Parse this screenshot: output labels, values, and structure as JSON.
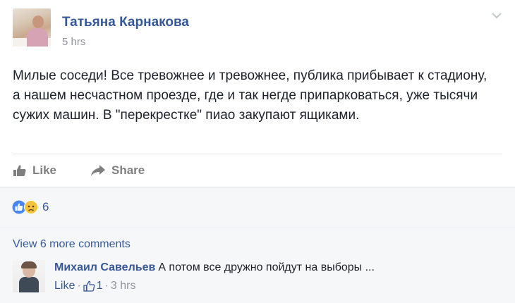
{
  "post": {
    "author": "Татьяна Карнакова",
    "timestamp": "5 hrs",
    "text": "Милые соседи! Все тревожнее и тревожнее, публика прибывает к стадиону, а нашем несчастном проезде, где и так негде припарковаться, уже тысячи сужих машин. В \"перекрестке\" пиао закупают ящиками."
  },
  "actions": {
    "like_label": "Like",
    "share_label": "Share"
  },
  "reactions": {
    "count": "6",
    "types": [
      "like",
      "sad"
    ]
  },
  "comments": {
    "view_more_label": "View 6 more comments",
    "items": [
      {
        "author": "Михаил Савельев",
        "text": "А потом все дружно пойдут на выборы ...",
        "like_label": "Like",
        "like_count": "1",
        "time": "3 hrs"
      }
    ]
  },
  "colors": {
    "link": "#365899",
    "meta": "#90949c",
    "text": "#1d2129",
    "like_reaction": "#4a86f2",
    "sad_reaction": "#f5c33b"
  }
}
